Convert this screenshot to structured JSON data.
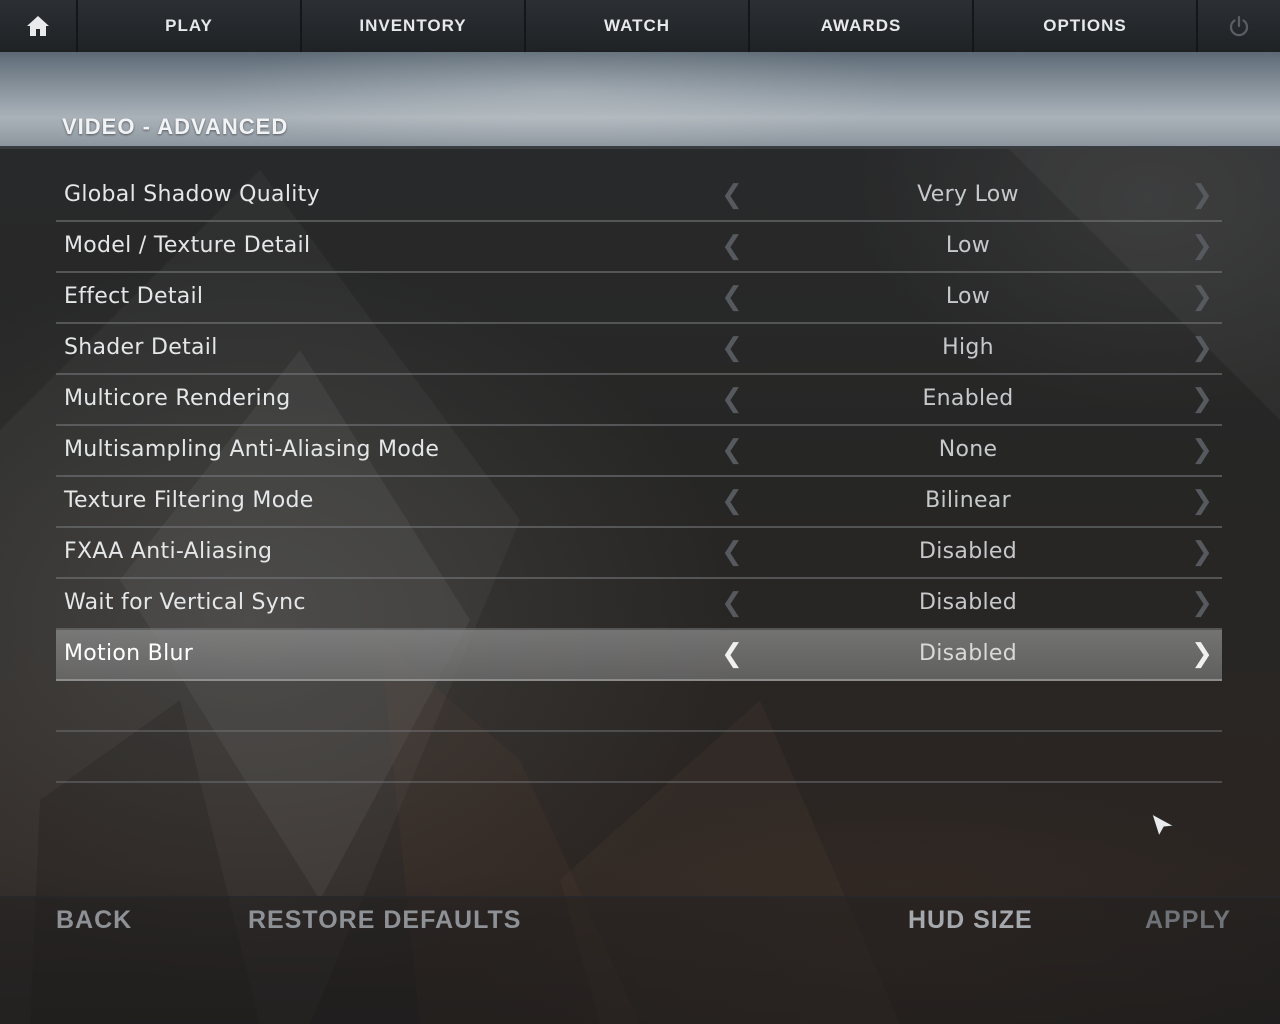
{
  "nav": {
    "home_icon": "home-icon",
    "tabs": [
      {
        "label": "PLAY"
      },
      {
        "label": "INVENTORY"
      },
      {
        "label": "WATCH"
      },
      {
        "label": "AWARDS"
      },
      {
        "label": "OPTIONS"
      }
    ],
    "power_icon": "power-icon"
  },
  "page": {
    "title": "VIDEO - ADVANCED"
  },
  "settings": [
    {
      "label": "Global Shadow Quality",
      "value": "Very Low"
    },
    {
      "label": "Model / Texture Detail",
      "value": "Low"
    },
    {
      "label": "Effect Detail",
      "value": "Low"
    },
    {
      "label": "Shader Detail",
      "value": "High"
    },
    {
      "label": "Multicore Rendering",
      "value": "Enabled"
    },
    {
      "label": "Multisampling Anti-Aliasing Mode",
      "value": "None"
    },
    {
      "label": "Texture Filtering Mode",
      "value": "Bilinear"
    },
    {
      "label": "FXAA Anti-Aliasing",
      "value": "Disabled"
    },
    {
      "label": "Wait for Vertical Sync",
      "value": "Disabled"
    },
    {
      "label": "Motion Blur",
      "value": "Disabled",
      "selected": true
    }
  ],
  "arrows": {
    "left": "❮",
    "right": "❯"
  },
  "footer": {
    "back": "BACK",
    "restore_defaults": "RESTORE DEFAULTS",
    "hud_size": "HUD SIZE",
    "apply": "APPLY"
  },
  "colors": {
    "header_band": "#909aa3",
    "nav_bg": "#2c2f33",
    "selected_row": "#8c8c8c"
  }
}
